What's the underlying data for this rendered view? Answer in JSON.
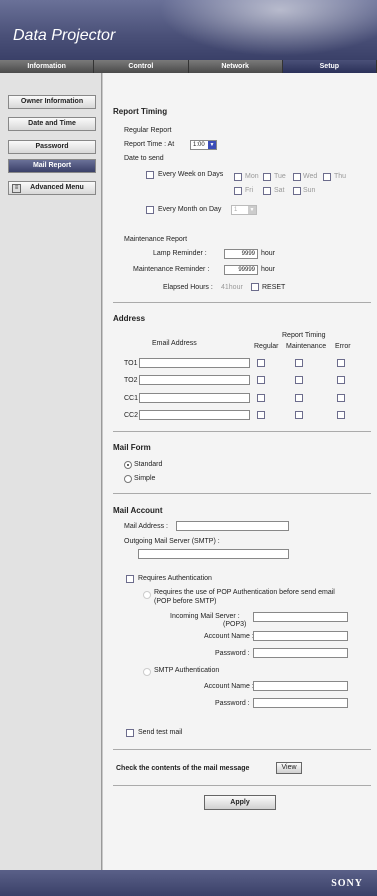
{
  "app": {
    "title": "Data Projector",
    "brand": "SONY"
  },
  "tabs": [
    "Information",
    "Control",
    "Network",
    "Setup"
  ],
  "sidebar": {
    "items": [
      "Owner Information",
      "Date and Time",
      "Password",
      "Mail Report",
      "Advanced Menu"
    ]
  },
  "report_timing": {
    "heading": "Report Timing",
    "regular_label": "Regular Report",
    "time_label": "Report Time : At",
    "time_value": "1:00",
    "date_label": "Date to send",
    "every_week_label": "Every Week on Days",
    "days": [
      "Mon",
      "Tue",
      "Wed",
      "Thu",
      "Fri",
      "Sat",
      "Sun"
    ],
    "every_month_label": "Every Month on Day",
    "month_day": "1",
    "maint_label": "Maintenance Report",
    "lamp_label": "Lamp Reminder :",
    "lamp_value": "9999",
    "maint_rem_label": "Maintenance Reminder :",
    "maint_rem_value": "99999",
    "unit": "hour",
    "elapsed_label": "Elapsed Hours :",
    "elapsed_value": "41hour",
    "reset_label": "RESET"
  },
  "address": {
    "heading": "Address",
    "email_col": "Email Address",
    "timing_col": "Report Timing",
    "cols": [
      "Regular",
      "Maintenance",
      "Error"
    ],
    "rows": [
      "TO1 :",
      "TO2 :",
      "CC1 :",
      "CC2 :"
    ]
  },
  "mail_form": {
    "heading": "Mail Form",
    "options": [
      "Standard",
      "Simple"
    ]
  },
  "mail_account": {
    "heading": "Mail Account",
    "mail_address_label": "Mail Address :",
    "smtp_label": "Outgoing Mail Server (SMTP) :",
    "requires_auth_label": "Requires Authentication",
    "pop_line1": "Requires the use of POP Authentication before send email",
    "pop_line2": "(POP before SMTP)",
    "incoming_line1": "Incoming Mail Server :",
    "incoming_line2": "(POP3)",
    "account_label": "Account Name :",
    "password_label": "Password :",
    "smtp_auth_label": "SMTP Authentication",
    "send_test_label": "Send test mail"
  },
  "check": {
    "label": "Check the contents of the mail message",
    "button": "View"
  },
  "apply": "Apply"
}
